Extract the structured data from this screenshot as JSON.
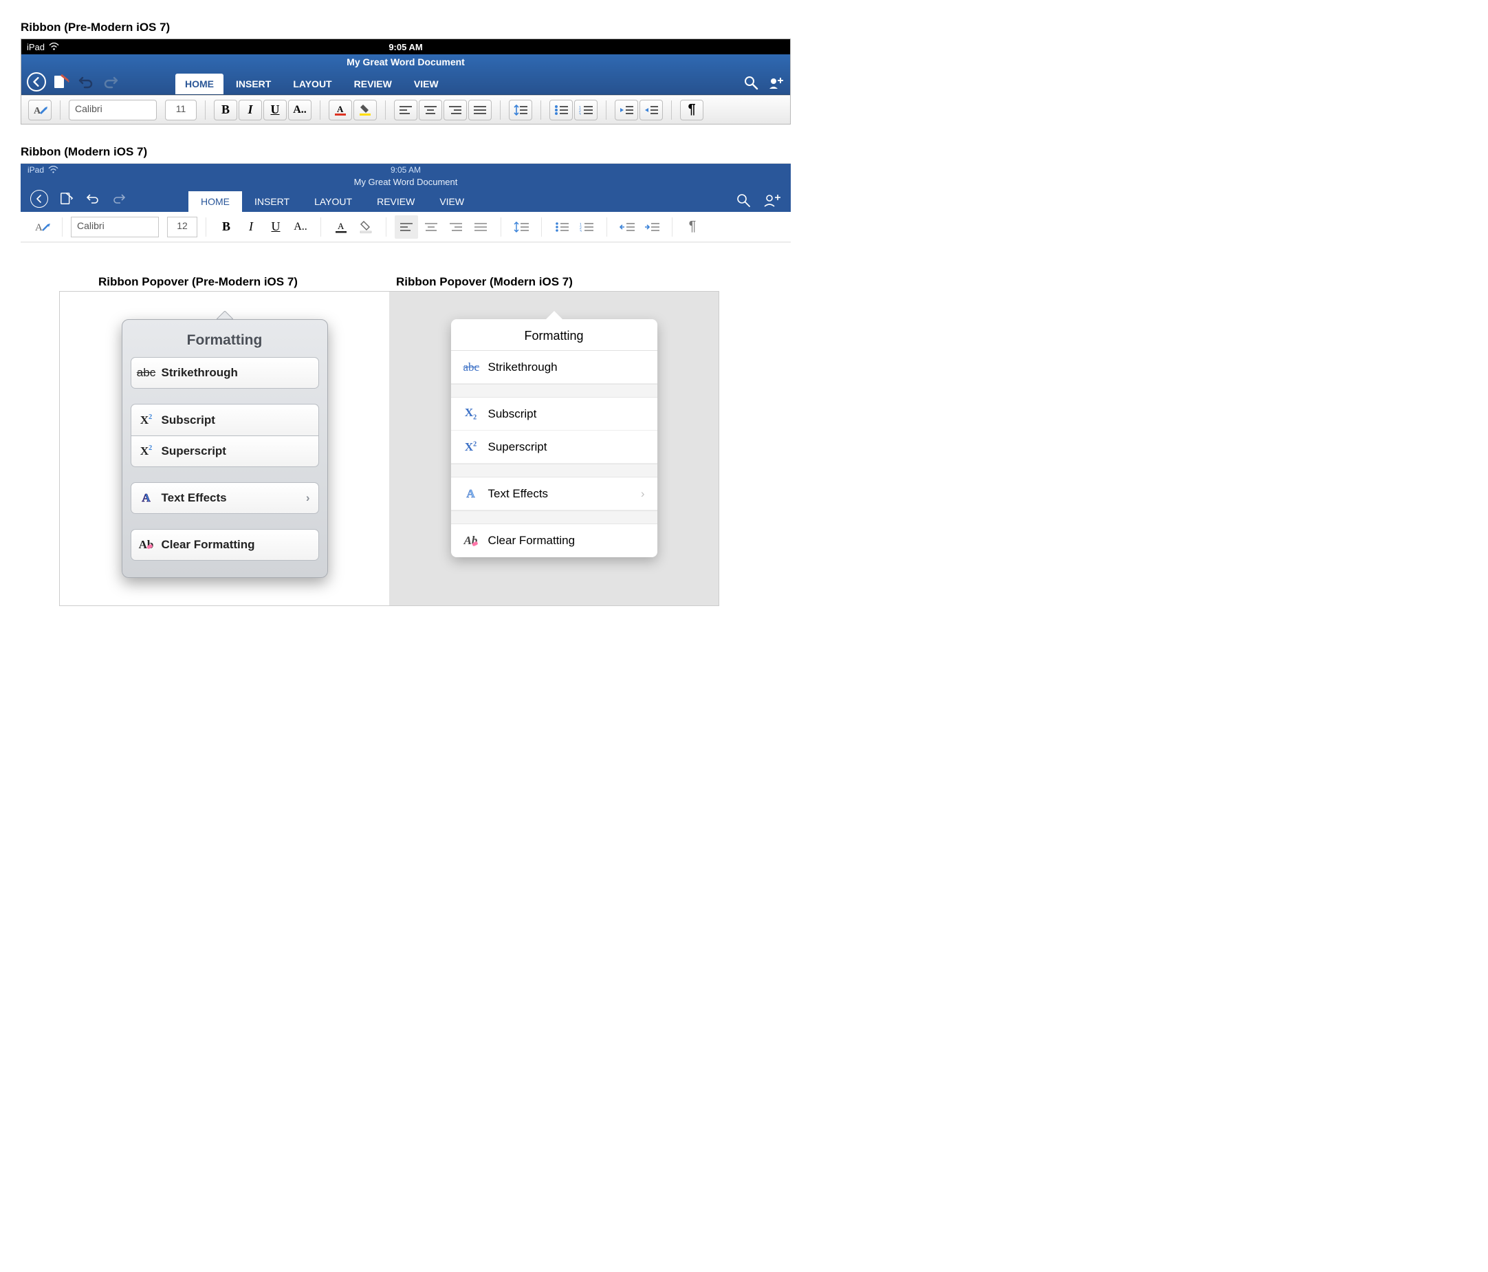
{
  "labels": {
    "ribbon1": "Ribbon (Pre-Modern iOS 7)",
    "ribbon2": "Ribbon (Modern iOS 7)",
    "popover1": "Ribbon Popover (Pre-Modern iOS 7)",
    "popover2": "Ribbon Popover (Modern iOS 7)"
  },
  "status": {
    "device": "iPad",
    "time": "9:05 AM"
  },
  "doc": {
    "title": "My Great Word Document"
  },
  "tabs": {
    "home": "HOME",
    "insert": "INSERT",
    "layout": "LAYOUT",
    "review": "REVIEW",
    "view": "VIEW"
  },
  "ribbon1": {
    "font": "Calibri",
    "size": "11"
  },
  "ribbon2": {
    "font": "Calibri",
    "size": "12"
  },
  "popover": {
    "title": "Formatting",
    "strike": "Strikethrough",
    "subscript": "Subscript",
    "superscript": "Superscript",
    "texteffects": "Text Effects",
    "clear": "Clear Formatting",
    "abc": "abc",
    "xsub": "X",
    "xsup": "X",
    "A": "A",
    "Ab": "Ab"
  },
  "colors": {
    "brand": "#2a579a"
  }
}
